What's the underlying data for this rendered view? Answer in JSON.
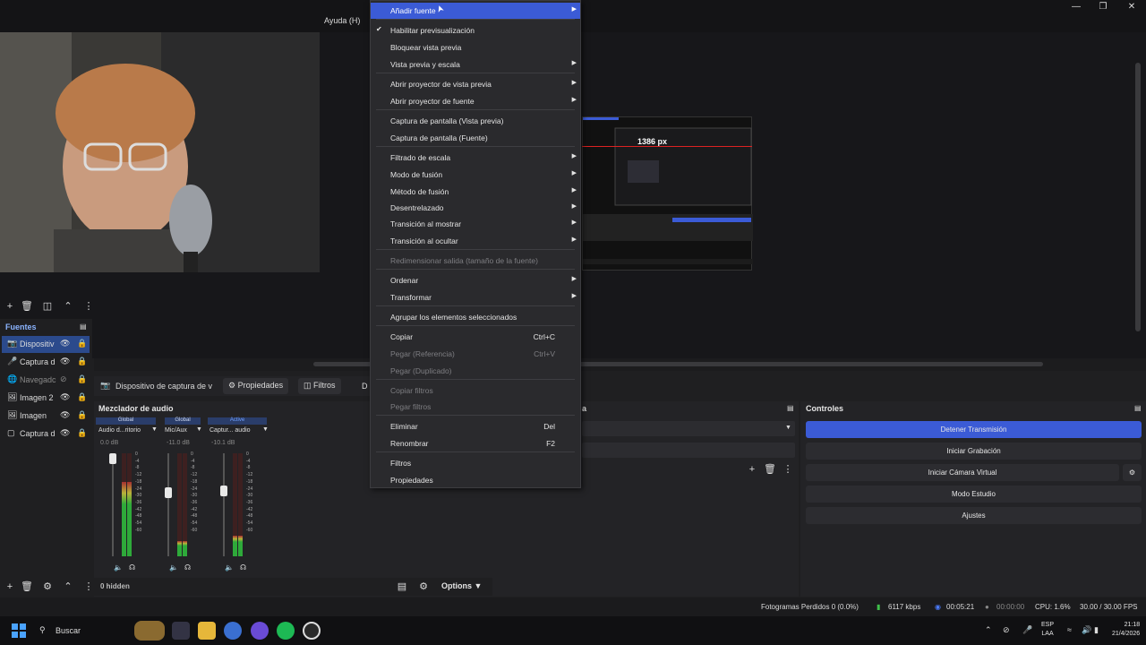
{
  "menu": {
    "help": "Ayuda (H)"
  },
  "preview": {
    "measure_label": "1386 px"
  },
  "sources": {
    "title": "Fuentes",
    "items": [
      {
        "label": "Dispositiv",
        "icon": "camera-icon",
        "selected": true
      },
      {
        "label": "Captura d",
        "icon": "microphone-icon",
        "selected": false
      },
      {
        "label": "Navegadc",
        "icon": "globe-icon",
        "selected": false
      },
      {
        "label": "Imagen 2",
        "icon": "image-icon",
        "selected": false
      },
      {
        "label": "Imagen",
        "icon": "image-icon",
        "selected": false
      },
      {
        "label": "Captura d",
        "icon": "window-icon",
        "selected": false
      }
    ]
  },
  "properties_bar": {
    "source_name": "Dispositivo de captura de v",
    "properties_label": "Propiedades",
    "filters_label": "Filtros",
    "extra_label": "D"
  },
  "mixer": {
    "title": "Mezclador de audio",
    "channels": [
      {
        "tag": "Global",
        "name": "Audio d...ritorio",
        "db": "0.0 dB",
        "level": 0.72
      },
      {
        "tag": "Global",
        "name": "Mic/Aux",
        "db": "-11.0 dB",
        "level": 0.15
      },
      {
        "tag": "Active",
        "name": "Captur... audio",
        "db": "-10.1 dB",
        "level": 0.2
      }
    ],
    "scale": [
      "0",
      "-4",
      "-8",
      "-12",
      "-18",
      "-24",
      "-30",
      "-36",
      "-42",
      "-48",
      "-54",
      "-60"
    ]
  },
  "bottom": {
    "hidden_count": "0 hidden",
    "options_label": "Options"
  },
  "transitions": {
    "title_fragment": "a"
  },
  "controls": {
    "title": "Controles",
    "buttons": [
      {
        "label": "Detener Transmisión",
        "active": true
      },
      {
        "label": "Iniciar Grabación",
        "active": false
      },
      {
        "label": "Iniciar Cámara Virtual",
        "active": false
      },
      {
        "label": "Modo Estudio",
        "active": false
      },
      {
        "label": "Ajustes",
        "active": false
      }
    ]
  },
  "statusbar": {
    "dropped_frames": "Fotogramas Perdidos 0 (0.0%)",
    "bitrate": "6117 kbps",
    "stream_time": "00:05:21",
    "record_time": "00:00:00",
    "cpu": "CPU: 1.6%",
    "fps": "30.00 / 30.00 FPS"
  },
  "context_menu": {
    "items": [
      {
        "label": "Añadir fuente",
        "submenu": true,
        "hover": true
      },
      {
        "label": "Habilitar previsualización",
        "checked": true
      },
      {
        "label": "Bloquear vista previa"
      },
      {
        "label": "Vista previa y escala",
        "submenu": true
      },
      {
        "label": "Abrir proyector de vista previa",
        "submenu": true
      },
      {
        "label": "Abrir proyector de fuente",
        "submenu": true
      },
      {
        "label": "Captura de pantalla (Vista previa)"
      },
      {
        "label": "Captura de pantalla (Fuente)"
      },
      {
        "label": "Filtrado de escala",
        "submenu": true
      },
      {
        "label": "Modo de fusión",
        "submenu": true
      },
      {
        "label": "Método de fusión",
        "submenu": true
      },
      {
        "label": "Desentrelazado",
        "submenu": true
      },
      {
        "label": "Transición al mostrar",
        "submenu": true
      },
      {
        "label": "Transición al ocultar",
        "submenu": true
      },
      {
        "label": "Redimensionar salida (tamaño de la fuente)",
        "disabled": true
      },
      {
        "label": "Ordenar",
        "submenu": true
      },
      {
        "label": "Transformar",
        "submenu": true
      },
      {
        "label": "Agrupar los elementos seleccionados"
      },
      {
        "label": "Copiar",
        "shortcut": "Ctrl+C"
      },
      {
        "label": "Pegar (Referencia)",
        "shortcut": "Ctrl+V",
        "disabled": true
      },
      {
        "label": "Pegar (Duplicado)",
        "disabled": true
      },
      {
        "label": "Copiar filtros",
        "disabled": true
      },
      {
        "label": "Pegar filtros",
        "disabled": true
      },
      {
        "label": "Eliminar",
        "shortcut": "Del"
      },
      {
        "label": "Renombrar",
        "shortcut": "F2"
      },
      {
        "label": "Filtros"
      },
      {
        "label": "Propiedades"
      }
    ]
  },
  "taskbar": {
    "search_placeholder": "Buscar",
    "lang_top": "ESP",
    "lang_bottom": "LAA",
    "time": "21:18",
    "date": "21/4/2026"
  },
  "colors": {
    "accent": "#3b5bd6",
    "menu_bg": "#2a2a2d",
    "app_bg": "#1f1f21"
  }
}
